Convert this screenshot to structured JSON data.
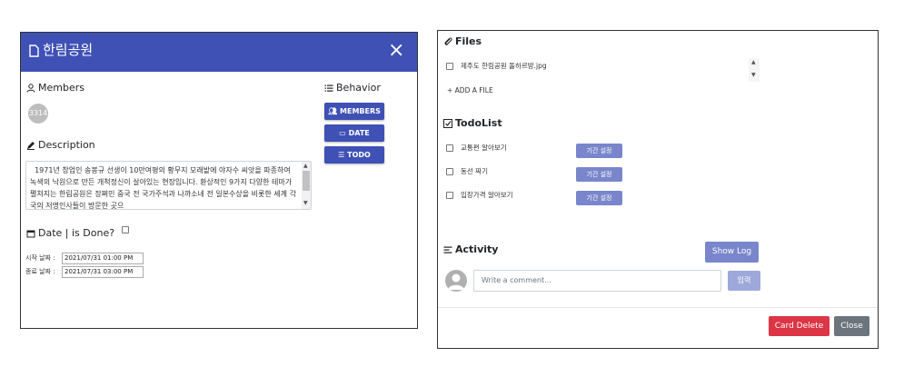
{
  "card": {
    "title": "한림공원",
    "close_symbol": "×"
  },
  "members": {
    "label": "Members",
    "avatar_text": "3314"
  },
  "description": {
    "label": "Description",
    "text": "  1971년 창업인 송봉규 선생이 10만여평의 황무지 모래밭에 야자수 씨앗을 파종하여 녹색의 낙원으로 만든 개척정신이 살아있는 현장입니다. 환상적인 9가지 다양한 테마가 펼쳐지는 한림공원은 장쩌민 중국 전 국가주석과 나까소네 전 일본수상을 비롯한 세계 각국의 저명인사들이 방문한 곳으"
  },
  "date_section": {
    "label": "Date | is Done?",
    "start_label": "시작 날짜 :",
    "start_value": "2021/07/31 01:00 PM",
    "end_label": "종료 날짜 :",
    "end_value": "2021/07/31 03:00 PM"
  },
  "behavior": {
    "label": "Behavior",
    "buttons": [
      "MEMBERS",
      "DATE",
      "TODO"
    ]
  },
  "files": {
    "label": "Files",
    "items": [
      "제주도 한림공원 돌하르방.jpg"
    ],
    "add_label": "+ ADD A FILE"
  },
  "todo": {
    "label": "TodoList",
    "items": [
      {
        "text": "교통편 알아보기",
        "button": "기간 설정"
      },
      {
        "text": "동선 짜기",
        "button": "기간 설정"
      },
      {
        "text": "입장가격 알아보기",
        "button": "기간 설정"
      }
    ]
  },
  "activity": {
    "label": "Activity",
    "show_log": "Show Log",
    "comment_placeholder": "Write a comment...",
    "submit": "입력"
  },
  "footer": {
    "delete": "Card Delete",
    "close": "Close"
  },
  "colors": {
    "header": "#3f51b5",
    "light_button": "#7986cb",
    "delete": "#dc3545",
    "close": "#6c757d"
  }
}
